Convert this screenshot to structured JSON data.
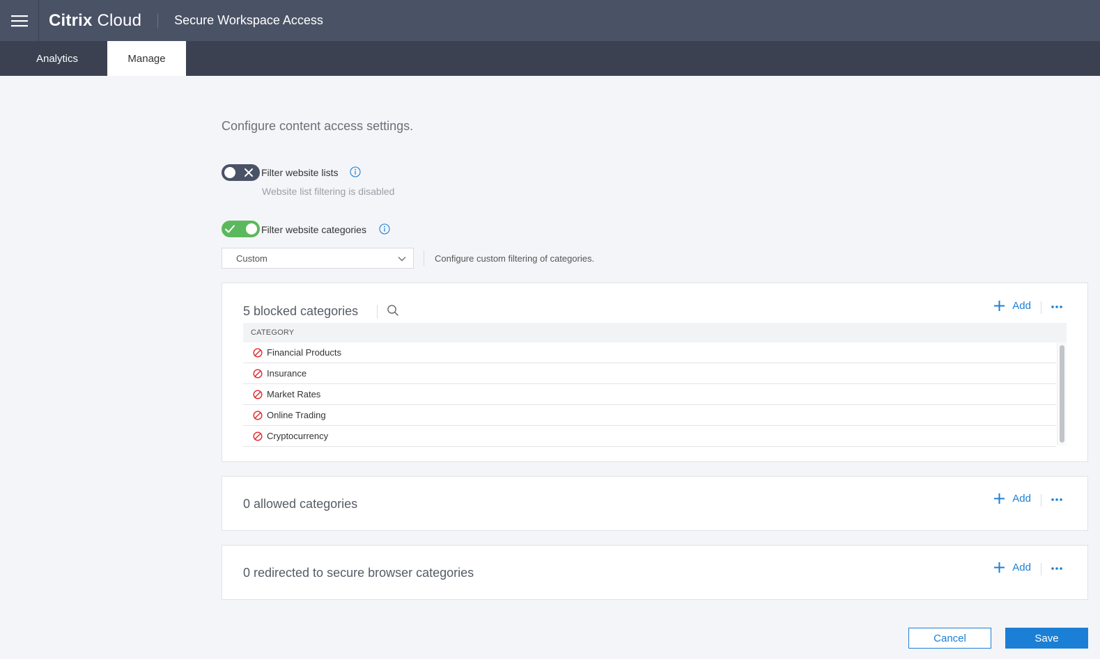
{
  "header": {
    "brand_bold": "Citrix",
    "brand_light": "Cloud",
    "product": "Secure Workspace Access"
  },
  "tabs": [
    {
      "label": "Analytics",
      "active": false
    },
    {
      "label": "Manage",
      "active": true
    }
  ],
  "intro": "Configure content access settings.",
  "website_lists": {
    "label": "Filter website lists",
    "enabled": false,
    "status": "Website list filtering is disabled"
  },
  "website_categories": {
    "label": "Filter website categories",
    "enabled": true,
    "mode": "Custom",
    "mode_description": "Configure custom filtering of categories."
  },
  "blocked": {
    "title": "5 blocked categories",
    "column": "CATEGORY",
    "add_label": "Add",
    "rows": [
      "Financial Products",
      "Insurance",
      "Market Rates",
      "Online Trading",
      "Cryptocurrency"
    ]
  },
  "allowed": {
    "title": "0 allowed categories",
    "add_label": "Add"
  },
  "redirected": {
    "title": "0 redirected to secure browser categories",
    "add_label": "Add"
  },
  "footer": {
    "cancel_label": "Cancel",
    "save_label": "Save"
  },
  "colors": {
    "topbar": "#4a5266",
    "tabbar": "#3b4150",
    "accent": "#1b7fd6",
    "toggle_on": "#5cb85c",
    "block_red": "#e0262b"
  },
  "icons": [
    "hamburger-icon",
    "info-icon",
    "chevron-down-icon",
    "search-icon",
    "plus-icon",
    "more-icon",
    "block-icon",
    "x-icon",
    "check-icon"
  ]
}
